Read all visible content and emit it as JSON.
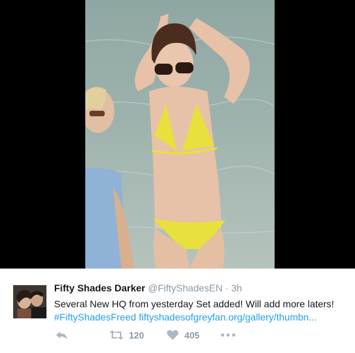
{
  "tweet": {
    "author_name": "Fifty Shades Darker",
    "handle": "@FiftyShadesEN",
    "separator": "·",
    "time": "3h",
    "text": "Several New HQ from yesterday Set added! Will add more laters!",
    "hashtag": "#FiftyShadesFreed",
    "link": "fiftyshadesofgreyfan.org/gallery/thumbn...",
    "retweet_count": "120",
    "like_count": "405"
  },
  "icons": {
    "reply": "reply-icon",
    "retweet": "retweet-icon",
    "like": "heart-icon",
    "more": "more-icon"
  },
  "colors": {
    "link": "#1da1f2",
    "muted": "#8899a6",
    "action_icon": "#aab8c2",
    "bikini": "#e8e03c"
  }
}
